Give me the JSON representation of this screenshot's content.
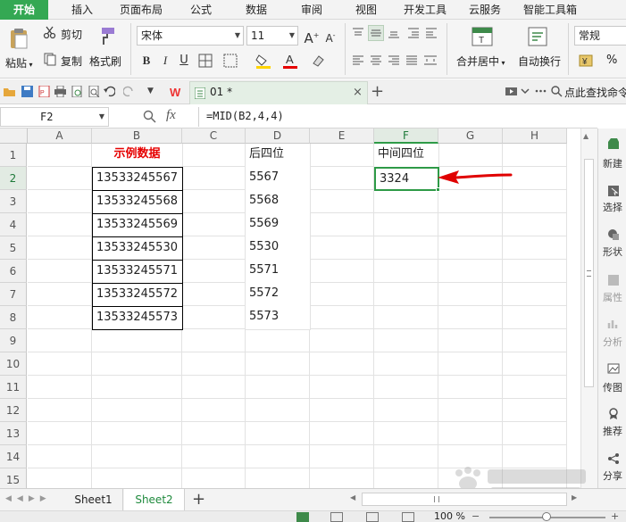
{
  "menu": {
    "tabs": [
      "开始",
      "插入",
      "页面布局",
      "公式",
      "数据",
      "审阅",
      "视图",
      "开发工具",
      "云服务",
      "智能工具箱"
    ]
  },
  "ribbon": {
    "paste_label": "粘贴",
    "cut_label": "剪切",
    "copy_label": "复制",
    "format_painter_label": "格式刷",
    "font_name": "宋体",
    "font_size": "11",
    "merge_center_label": "合并居中",
    "wrap_text_label": "自动换行",
    "number_format": "常规",
    "percent_symbol": "%",
    "bold_glyph": "B",
    "italic_glyph": "I",
    "underline_glyph": "U"
  },
  "quick_access": {
    "doc_tab_label": "01 *",
    "search_label": "点此查找命令"
  },
  "formula_bar": {
    "name_box": "F2",
    "fx_label": "fx",
    "formula": "=MID(B2,4,4)"
  },
  "grid": {
    "columns": [
      "A",
      "B",
      "C",
      "D",
      "E",
      "F",
      "G",
      "H"
    ],
    "selected_column": "F",
    "rows": [
      "1",
      "2",
      "3",
      "4",
      "5",
      "6",
      "7",
      "8",
      "9",
      "10",
      "11",
      "12",
      "13",
      "14",
      "15"
    ],
    "selected_row": "2",
    "b_header": "示例数据",
    "d_header": "后四位",
    "f_header": "中间四位",
    "b_values": [
      "13533245567",
      "13533245568",
      "13533245569",
      "13533245530",
      "13533245571",
      "13533245572",
      "13533245573"
    ],
    "d_values": [
      "5567",
      "5568",
      "5569",
      "5530",
      "5571",
      "5572",
      "5573"
    ],
    "f_values": [
      "3324"
    ]
  },
  "sidebar": {
    "items": [
      {
        "label": "新建",
        "icon": "new-icon"
      },
      {
        "label": "选择",
        "icon": "select-icon"
      },
      {
        "label": "形状",
        "icon": "shape-icon"
      },
      {
        "label": "属性",
        "icon": "properties-icon"
      },
      {
        "label": "分析",
        "icon": "analysis-icon"
      },
      {
        "label": "传图",
        "icon": "upload-image-icon"
      },
      {
        "label": "推荐",
        "icon": "recommend-icon"
      },
      {
        "label": "分享",
        "icon": "share-icon"
      }
    ]
  },
  "sheets": {
    "tabs": [
      "Sheet1",
      "Sheet2"
    ],
    "active": "Sheet2",
    "add_symbol": "+"
  },
  "status": {
    "zoom": "100 %"
  },
  "colors": {
    "accent_green": "#2e9a47",
    "header_red": "#e60000",
    "arrow_red": "#e00000",
    "menu_active_bg": "#34a853"
  }
}
